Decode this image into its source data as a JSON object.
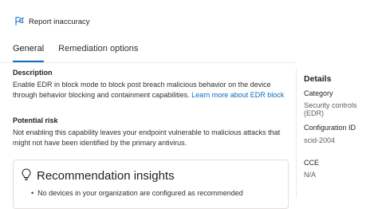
{
  "header": {
    "report_label": "Report inaccuracy"
  },
  "tabs": [
    {
      "label": "General"
    },
    {
      "label": "Remediation options"
    }
  ],
  "description": {
    "title": "Description",
    "line1": "Enable EDR in block mode to block post breach malicious behavior on the device",
    "line2": "through behavior blocking and containment capabilities.",
    "link": "Learn more about EDR block"
  },
  "risk": {
    "title": "Potential risk",
    "line1": "Not enabling this capability leaves your endpoint vulnerable to malicious attacks that",
    "line2": "might not have been identified by the primary antivirus."
  },
  "details": {
    "title": "Details",
    "category_label": "Category",
    "category_value": "Security controls (EDR)",
    "config_label": "Configuration ID",
    "config_value": "scid-2004",
    "cce_label": "CCE",
    "cce_value": "N/A"
  },
  "insights": {
    "title": "Recommendation insights",
    "bullet": "No devices in your organization are configured as recommended"
  },
  "colors": {
    "accent": "#0f6cbd",
    "text": "#201f1e",
    "muted": "#605e5c",
    "divider": "#edebe9"
  }
}
